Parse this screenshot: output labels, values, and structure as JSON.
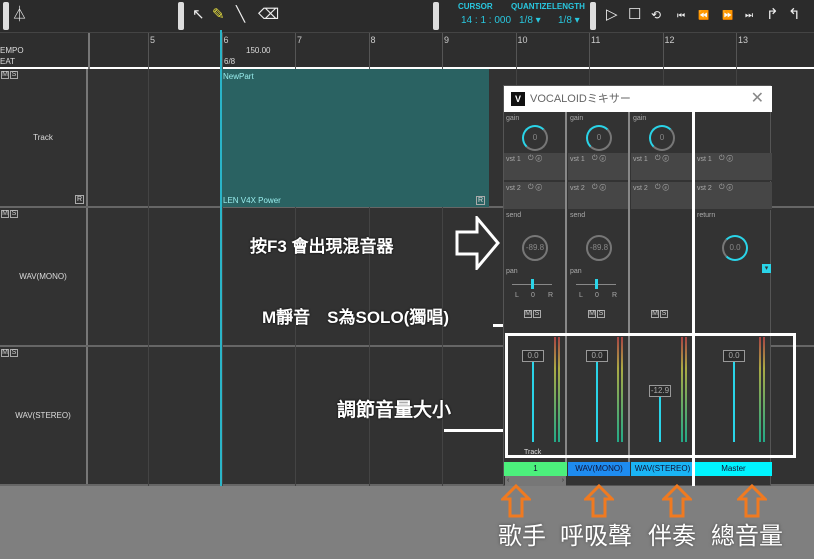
{
  "toolbar": {
    "cursor_label": "CURSOR",
    "cursor_value": "14 : 1 : 000",
    "quantize_label": "QUANTIZE",
    "quantize_value": "1/8 ▾",
    "length_label": "LENGTH",
    "length_value": "1/8 ▾",
    "tools": [
      "metronome-icon",
      "arrow-icon",
      "pencil-icon",
      "line-icon",
      "eraser-icon"
    ],
    "transport": [
      "play-icon",
      "stop-icon",
      "loop-icon",
      "to-start-icon",
      "rewind-icon",
      "fast-forward-icon",
      "to-end-icon",
      "marker-in-icon",
      "marker-out-icon"
    ]
  },
  "ruler": {
    "tempo_label": "EMPO",
    "beat_label": "EAT",
    "tempo_value": "150.00",
    "beat_value": "6/8",
    "bars": [
      "5",
      "6",
      "7",
      "8",
      "9",
      "10",
      "11",
      "12",
      "13"
    ]
  },
  "tracks": [
    {
      "name": "Track",
      "mute": "M",
      "solo": "S"
    },
    {
      "name": "WAV(MONO)",
      "mute": "M",
      "solo": "S"
    },
    {
      "name": "WAV(STEREO)",
      "mute": "M",
      "solo": "S"
    }
  ],
  "part": {
    "name": "NewPart",
    "singer": "LEN  V4X  Power",
    "r": "R"
  },
  "mixer": {
    "title": "VOCALOIDミキサー",
    "logo": "V",
    "gain": "gain",
    "vst1": "vst 1",
    "vst2": "vst 2",
    "send": "send",
    "return": "return",
    "pan": "pan",
    "pan_l": "L",
    "pan_r": "R",
    "channels": [
      {
        "label": "1",
        "gain": "0",
        "send": "-89.8",
        "pan": "0",
        "volume": "0.0",
        "color": "#4cf07c",
        "name": "Track"
      },
      {
        "label": "WAV(MONO)",
        "gain": "0",
        "send": "-89.8",
        "pan": "0",
        "volume": "0.0",
        "color": "#1e8cf0"
      },
      {
        "label": "WAV(STEREO)",
        "gain": "0",
        "volume": "-12.9",
        "color": "#1ab4f4"
      },
      {
        "label": "Master",
        "return": "0.0",
        "volume": "0.0",
        "color": "#00f4ff"
      }
    ]
  },
  "annotations": {
    "f3": "按F3 會出現混音器",
    "ms": "M靜音　S為SOLO(獨唱)",
    "volume": "調節音量大小",
    "singer": "歌手",
    "breath": "呼吸聲",
    "accomp": "伴奏",
    "master": "總音量"
  },
  "colors": {
    "accent": "#2ad4e8",
    "part": "#2a6262",
    "annotation_arrow": "#f07a20"
  }
}
